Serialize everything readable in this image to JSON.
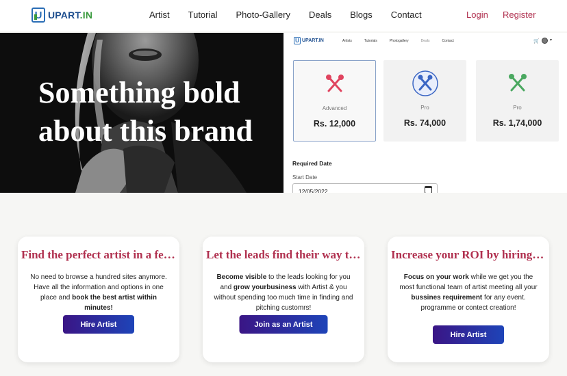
{
  "brand": {
    "name": "UPART",
    "tld": ".IN",
    "mark": "U"
  },
  "nav": {
    "links": [
      "Artist",
      "Tutorial",
      "Photo-Gallery",
      "Deals",
      "Blogs",
      "Contact"
    ],
    "login": "Login",
    "register": "Register"
  },
  "hero": {
    "heading_line1": "Something bold",
    "heading_line2": "about this brand"
  },
  "preview": {
    "brand": "UPART.IN",
    "links": [
      "Artists",
      "Tutorials",
      "Photogallery",
      "Deals",
      "Contact"
    ],
    "plans": [
      {
        "name": "Advanced",
        "price": "Rs. 12,000",
        "icon": "crossed-tools-icon",
        "color": "#e0445f"
      },
      {
        "name": "Pro",
        "price": "Rs. 74,000",
        "icon": "crossed-tools-icon",
        "color": "#3b66c4"
      },
      {
        "name": "Pro",
        "price": "Rs. 1,74,000",
        "icon": "crossed-tools-icon",
        "color": "#4aa860"
      }
    ],
    "required_date_label": "Required Date",
    "start_date_label": "Start Date",
    "start_date_value": "12/05/2022"
  },
  "cards": [
    {
      "title": "Find the perfect artist in a few minutes",
      "body": [
        {
          "t": "No need to browse a hundred sites anymore. Have all the information and options in one place and ",
          "b": false
        },
        {
          "t": "book the best artist within minutes!",
          "b": true
        }
      ],
      "button": "Hire Artist"
    },
    {
      "title": "Let the leads find their way to you",
      "body": [
        {
          "t": "Become visible",
          "b": true
        },
        {
          "t": " to the leads looking for you and ",
          "b": false
        },
        {
          "t": "grow yourbusiness",
          "b": true
        },
        {
          "t": " with Artist & you without spending too much time in finding and pitching customrs!",
          "b": false
        }
      ],
      "button": "Join as an Artist"
    },
    {
      "title": "Increase your ROI by hiring artists",
      "body": [
        {
          "t": "Focus on your work",
          "b": true
        },
        {
          "t": " while we get you the most functional team of artist meeting all your ",
          "b": false
        },
        {
          "t": "bussines requirement",
          "b": true
        },
        {
          "t": " for any event. programme or contect creation!",
          "b": false
        }
      ],
      "button": "Hire Artist"
    }
  ],
  "colors": {
    "accent": "#b0304f",
    "button_start": "#3a1585",
    "button_end": "#1e44b8",
    "logo_blue": "#2a6db5",
    "logo_green": "#3a9a3e"
  }
}
